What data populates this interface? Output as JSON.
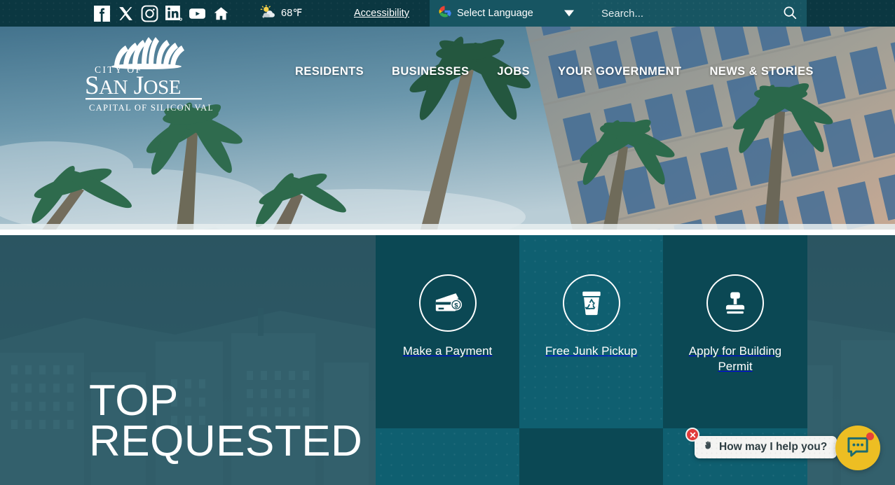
{
  "topbar": {
    "social_links": [
      {
        "name": "facebook-icon",
        "label": "Facebook"
      },
      {
        "name": "x-twitter-icon",
        "label": "X"
      },
      {
        "name": "instagram-icon",
        "label": "Instagram"
      },
      {
        "name": "linkedin-icon",
        "label": "LinkedIn"
      },
      {
        "name": "youtube-icon",
        "label": "YouTube"
      },
      {
        "name": "nextdoor-icon",
        "label": "Nextdoor"
      }
    ],
    "weather": {
      "icon": "sun-behind-cloud-icon",
      "temperature": "68℉"
    },
    "accessibility_label": "Accessibility",
    "language": {
      "icon": "google-translate-icon",
      "selected": "Select Language",
      "caret": "chevron-down-icon"
    },
    "search": {
      "placeholder": "Search...",
      "value": "",
      "icon": "search-icon"
    },
    "colors": {
      "bar_bg": "#0b3741",
      "field_bg": "#175562"
    }
  },
  "hero": {
    "logo": {
      "line1": "CITY OF",
      "line2": "SAN JOSE",
      "tagline": "CAPITAL OF SILICON VALLEY",
      "mark": "sunburst-palm-icon"
    },
    "nav": [
      {
        "label": "RESIDENTS",
        "name": "nav-residents"
      },
      {
        "label": "BUSINESSES",
        "name": "nav-businesses"
      },
      {
        "label": "JOBS",
        "name": "nav-jobs"
      },
      {
        "label": "YOUR GOVERNMENT",
        "name": "nav-your-government"
      },
      {
        "label": "NEWS & STORIES",
        "name": "nav-news-stories"
      }
    ]
  },
  "top_requested": {
    "heading_line1": "TOP",
    "heading_line2": "REQUESTED",
    "tiles": [
      {
        "label": "Make a Payment",
        "icon": "credit-card-dollar-icon",
        "shade": "dark"
      },
      {
        "label": "Free Junk Pickup",
        "icon": "recycle-bin-icon",
        "shade": "light"
      },
      {
        "label": "Apply for Building Permit",
        "icon": "rubber-stamp-icon",
        "shade": "dark"
      }
    ],
    "colors": {
      "tile_dark": "#0b4854",
      "tile_light": "#0f5f70",
      "section_bg": "#2a5360"
    }
  },
  "chat_widget": {
    "greeting": "How may I help you?",
    "greeting_icon": "waving-hand-icon",
    "close_icon": "close-icon",
    "fab_icon": "chat-bubble-icon",
    "has_notification": true,
    "colors": {
      "fab": "#edbe23",
      "close": "#e13b3b",
      "notification": "#e8413a"
    }
  }
}
